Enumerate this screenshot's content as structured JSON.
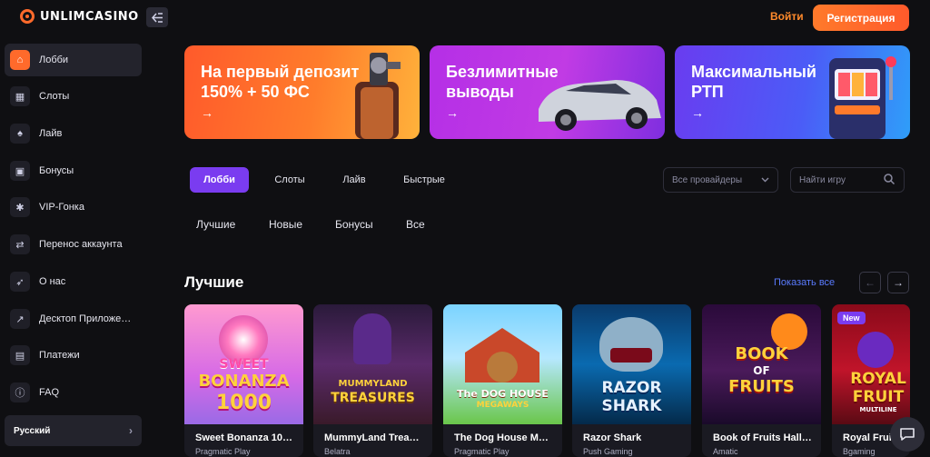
{
  "header": {
    "logo_text": "UNLIMCASINO",
    "login": "Войти",
    "register": "Регистрация"
  },
  "sidebar": {
    "items": [
      {
        "label": "Лобби",
        "icon": "home-icon",
        "glyph": "⌂"
      },
      {
        "label": "Слоты",
        "icon": "grid-icon",
        "glyph": "▦"
      },
      {
        "label": "Лайв",
        "icon": "spade-icon",
        "glyph": "♠"
      },
      {
        "label": "Бонусы",
        "icon": "gift-icon",
        "glyph": "▣"
      },
      {
        "label": "VIP-Гонка",
        "icon": "trophy-icon",
        "glyph": "✱"
      },
      {
        "label": "Перенос аккаунта",
        "icon": "transfer-icon",
        "glyph": "⇄"
      },
      {
        "label": "О нас",
        "icon": "rocket-icon",
        "glyph": "➶"
      },
      {
        "label": "Десктоп Приложе…",
        "icon": "external-link-icon",
        "glyph": "↗"
      },
      {
        "label": "Платежи",
        "icon": "wallet-icon",
        "glyph": "▤"
      },
      {
        "label": "FAQ",
        "icon": "info-icon",
        "glyph": "ⓘ"
      }
    ],
    "language": "Русский"
  },
  "banners": [
    {
      "text": "На первый депозит 150% + 50 ФС",
      "line1": "На первый депозит",
      "line2": "150% + 50 ФС",
      "arrow": "→"
    },
    {
      "text": "Безлимитные выводы",
      "line1": "Безлимитные",
      "line2": "выводы",
      "arrow": "→"
    },
    {
      "text": "Максимальный РТП",
      "line1": "Максимальный",
      "line2": "РТП",
      "arrow": "→"
    }
  ],
  "tabs": [
    "Лобби",
    "Слоты",
    "Лайв",
    "Быстрые"
  ],
  "provider_select": "Все провайдеры",
  "search_placeholder": "Найти игру",
  "filters": [
    "Лучшие",
    "Новые",
    "Бонусы",
    "Все"
  ],
  "section": {
    "title": "Лучшие",
    "show_all": "Показать все"
  },
  "games": [
    {
      "title": "Sweet Bonanza 10…",
      "provider": "Pragmatic Play",
      "art": [
        "SWEET",
        "BONANZA",
        "1000"
      ],
      "badge": ""
    },
    {
      "title": "MummyLand Trea…",
      "provider": "Belatra",
      "art": [
        "MUMMYLAND",
        "TREASURES"
      ],
      "badge": ""
    },
    {
      "title": "The Dog House M…",
      "provider": "Pragmatic Play",
      "art": [
        "The DOG HOUSE",
        "MEGAWAYS"
      ],
      "badge": ""
    },
    {
      "title": "Razor Shark",
      "provider": "Push Gaming",
      "art": [
        "RAZOR",
        "SHARK"
      ],
      "badge": ""
    },
    {
      "title": "Book of Fruits Hall…",
      "provider": "Amatic",
      "art": [
        "BOOK",
        "OF",
        "FRUITS"
      ],
      "badge": ""
    },
    {
      "title": "Royal Fruit",
      "provider": "Bgaming",
      "art": [
        "ROYAL",
        "FRUIT",
        "MULTILINE"
      ],
      "badge": "New"
    }
  ],
  "colors": {
    "accent_orange": "#ff6a2b",
    "accent_purple": "#7a3cf0",
    "link_blue": "#5a7bff",
    "background": "#0f0f12"
  }
}
